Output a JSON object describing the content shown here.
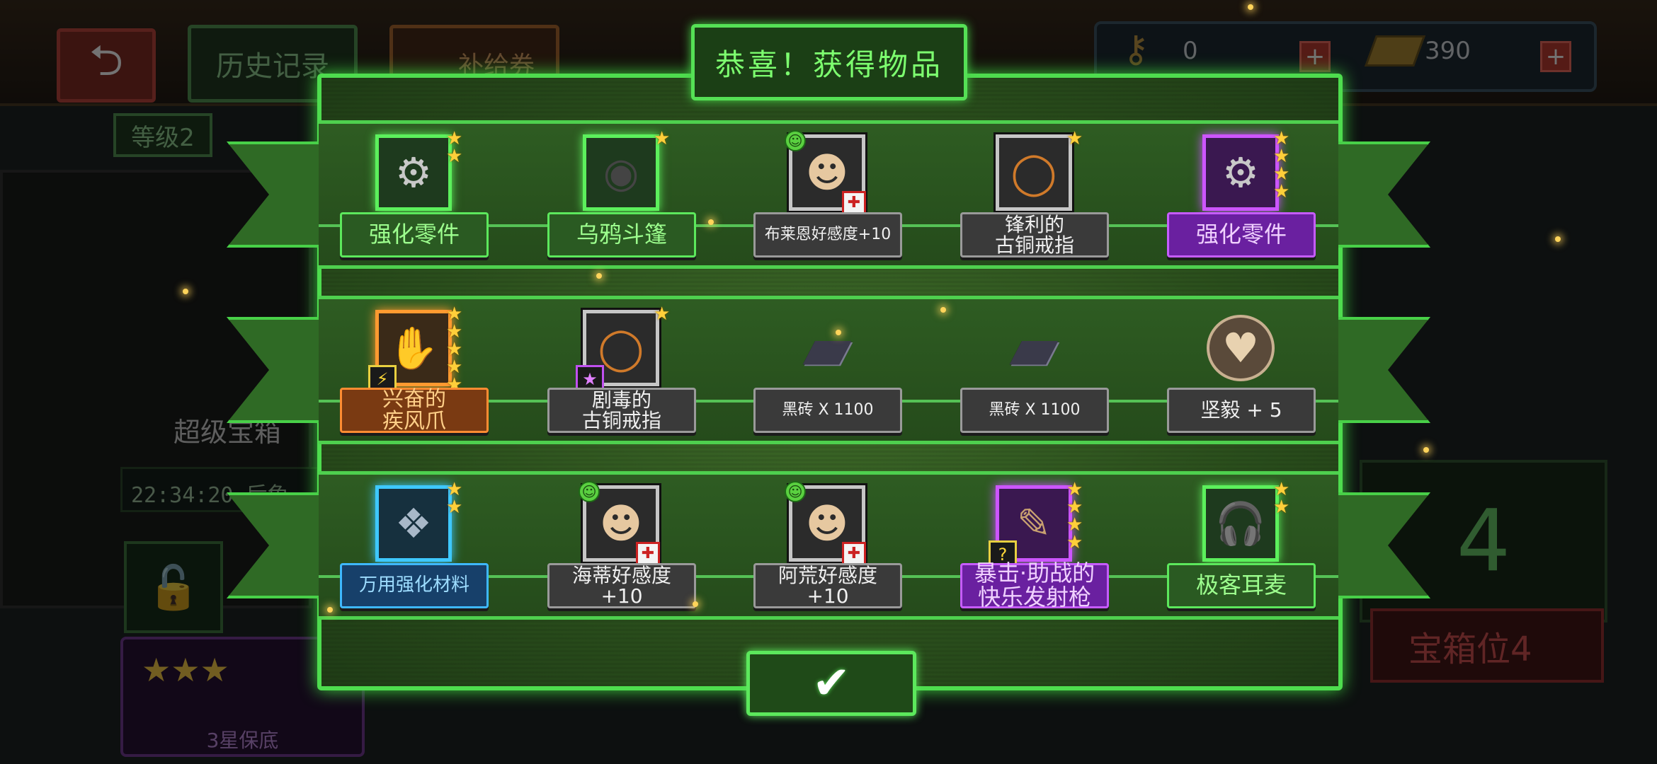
{
  "background": {
    "back_icon": "back-arrow-icon",
    "history_button": "历史记录",
    "supply_ticket_button": "补给券",
    "keys_count": "0",
    "gold_count": "390",
    "level_tag": "等级2",
    "super_box_label": "超级宝箱",
    "timer_text": "22:34:20 后免",
    "guarantee_label": "3星保底",
    "slot_number": "4",
    "slot_label": "宝箱位4",
    "supply_label": "补 给"
  },
  "modal": {
    "title": "恭喜！获得物品",
    "confirm_icon": "checkmark-icon",
    "rows": [
      [
        {
          "label": "强化零件",
          "rarity": "green",
          "stars": 2,
          "icon": "gear-part-icon"
        },
        {
          "label": "乌鸦斗篷",
          "rarity": "green",
          "stars": 1,
          "icon": "cloak-icon"
        },
        {
          "label": "布莱恩好感度+10",
          "rarity": "gray",
          "stars": 0,
          "icon": "character-portrait-icon",
          "affinity": true
        },
        {
          "label": "锋利的\n古铜戒指",
          "rarity": "gray",
          "stars": 1,
          "icon": "ring-icon"
        },
        {
          "label": "强化零件",
          "rarity": "purple",
          "stars": 4,
          "icon": "gear-part-icon"
        }
      ],
      [
        {
          "label": "兴奋的\n疾风爪",
          "rarity": "orange",
          "stars": 5,
          "icon": "claw-weapon-icon",
          "corner": "lightning-icon"
        },
        {
          "label": "剧毒的\n古铜戒指",
          "rarity": "gray",
          "stars": 1,
          "icon": "ring-icon",
          "corner": "purple-star-icon"
        },
        {
          "label": "黑砖 X 1100",
          "rarity": "gray",
          "stars": 0,
          "icon": "black-brick-icon"
        },
        {
          "label": "黑砖 X 1100",
          "rarity": "gray",
          "stars": 0,
          "icon": "black-brick-icon"
        },
        {
          "label": "坚毅 + 5",
          "rarity": "gray",
          "stars": 0,
          "icon": "heart-badge-icon"
        }
      ],
      [
        {
          "label": "万用强化材料",
          "rarity": "blue",
          "stars": 2,
          "icon": "material-crystal-icon"
        },
        {
          "label": "海蒂好感度+10",
          "rarity": "gray",
          "stars": 0,
          "icon": "character-portrait-icon",
          "affinity": true
        },
        {
          "label": "阿荒好感度+10",
          "rarity": "gray",
          "stars": 0,
          "icon": "character-portrait-icon",
          "affinity": true
        },
        {
          "label": "暴击·助战的\n快乐发射枪",
          "rarity": "purple",
          "stars": 4,
          "icon": "blaster-icon",
          "corner": "mystery-box-icon"
        },
        {
          "label": "极客耳麦",
          "rarity": "green",
          "stars": 2,
          "icon": "headset-icon"
        }
      ]
    ]
  },
  "colors": {
    "accent_green": "#4edc4e",
    "purple": "#cc55ff",
    "orange": "#ff9a30",
    "blue": "#3ec8ff",
    "star": "#ffcf3a"
  }
}
